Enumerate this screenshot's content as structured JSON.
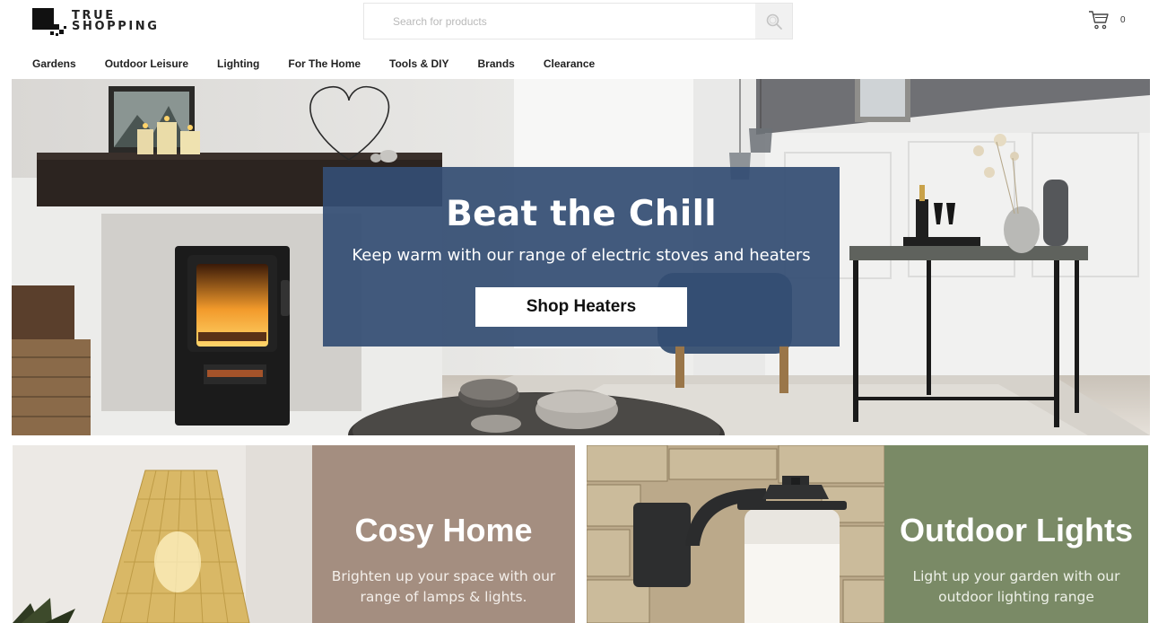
{
  "header": {
    "logo_line1": "TRUE",
    "logo_line2": "SHOPPING",
    "search_placeholder": "Search for products",
    "search_icon": "search-icon",
    "cart_icon": "cart-icon",
    "cart_count": "0"
  },
  "nav": {
    "items": [
      {
        "label": "Gardens"
      },
      {
        "label": "Outdoor Leisure"
      },
      {
        "label": "Lighting"
      },
      {
        "label": "For The Home"
      },
      {
        "label": "Tools & DIY"
      },
      {
        "label": "Brands"
      },
      {
        "label": "Clearance"
      }
    ]
  },
  "hero": {
    "title": "Beat the Chill",
    "subtitle": "Keep warm with our range of electric stoves and heaters",
    "button_label": "Shop Heaters",
    "panel_color": "#344e73"
  },
  "tiles": [
    {
      "title": "Cosy Home",
      "subtitle": "Brighten up your space with our range of lamps & lights.",
      "panel_color": "#a48e80"
    },
    {
      "title": "Outdoor Lights",
      "subtitle": "Light up your garden with our outdoor lighting range",
      "panel_color": "#7a8a66"
    }
  ]
}
